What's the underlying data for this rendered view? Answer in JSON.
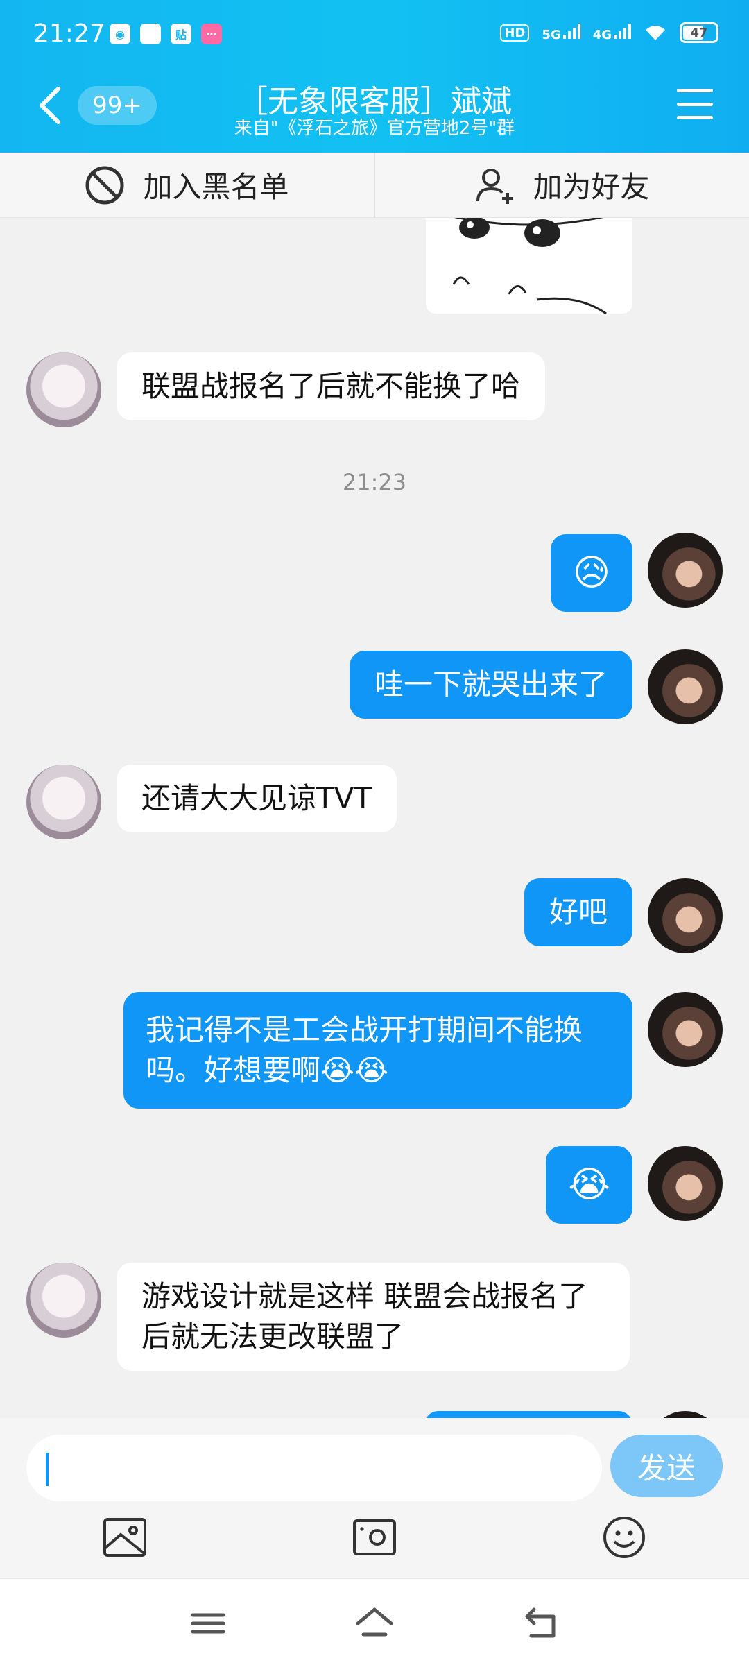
{
  "status_bar": {
    "time": "21:27",
    "network_5g": "5G",
    "network_4g": "4G",
    "hd": "HD",
    "battery": "47"
  },
  "header": {
    "unread_badge": "99+",
    "title": "［无象限客服］斌斌",
    "subtitle": "来自\"《浮石之旅》官方营地2号\"群"
  },
  "actions": {
    "blacklist": "加入黑名单",
    "add_friend": "加为好友"
  },
  "messages": [
    {
      "side": "in",
      "text": "联盟战报名了后就不能换了哈"
    },
    {
      "side": "out",
      "text": "😥"
    },
    {
      "side": "out",
      "text": "哇一下就哭出来了"
    },
    {
      "side": "in",
      "text": "还请大大见谅TVT"
    },
    {
      "side": "out",
      "text": "好吧"
    },
    {
      "side": "out",
      "text": "我记得不是工会战开打期间不能换吗。好想要啊😭😭"
    },
    {
      "side": "out",
      "text": "😭"
    },
    {
      "side": "in",
      "text": "游戏设计就是这样 联盟会战报名了后就无法更改联盟了"
    }
  ],
  "timestamp": "21:23",
  "input": {
    "value": "",
    "send_label": "发送"
  },
  "colors": {
    "header": "#13b6f1",
    "bubble_out": "#0f96f6",
    "send_btn": "#7cc6f8"
  }
}
